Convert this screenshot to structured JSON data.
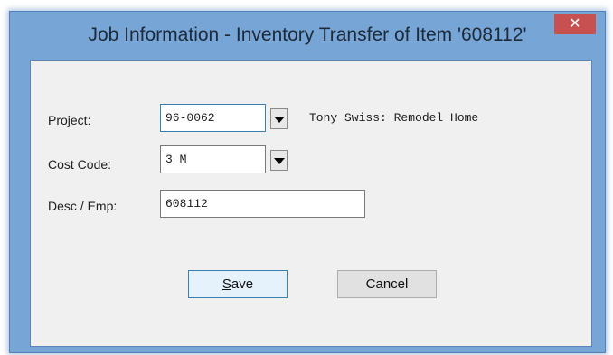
{
  "window": {
    "title": "Job Information - Inventory Transfer of Item '608112'",
    "close_glyph": "✕"
  },
  "form": {
    "project_label": "Project:",
    "project_value": "96-0062",
    "project_description": "Tony Swiss: Remodel Home",
    "cost_code_label": "Cost Code:",
    "cost_code_value": "3 M",
    "desc_emp_label": "Desc / Emp:",
    "desc_emp_value": "608112"
  },
  "buttons": {
    "save_mnemonic": "S",
    "save_rest": "ave",
    "cancel_label": "Cancel"
  },
  "icons": {
    "close": "close-icon",
    "dropdown": "chevron-down-icon"
  },
  "colors": {
    "title_bar": "#77a5d6",
    "close_button": "#c75050",
    "client_area": "#f0f0f0"
  }
}
